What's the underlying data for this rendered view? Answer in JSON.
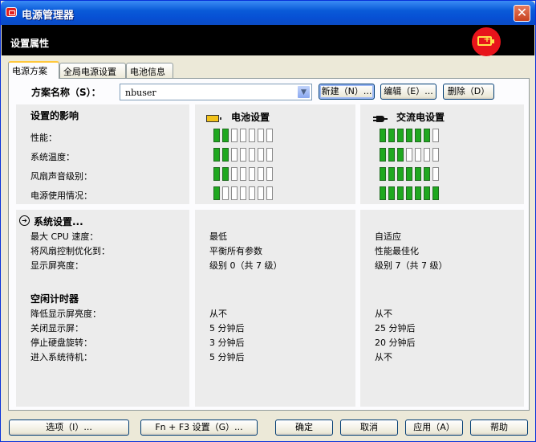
{
  "window": {
    "title": "电源管理器",
    "close_glyph": "✕"
  },
  "header": {
    "title": "设置属性",
    "logo_icon": "battery-charge-logo-icon",
    "logo_plus": "+"
  },
  "tabs": [
    {
      "label": "电源方案",
      "active": true
    },
    {
      "label": "全局电源设置",
      "active": false
    },
    {
      "label": "电池信息",
      "active": false
    }
  ],
  "scheme": {
    "label": "方案名称（S）：",
    "value": "nbuser",
    "buttons": {
      "new": "新建（N）...",
      "edit": "编辑（E）...",
      "delete": "删除（D）"
    }
  },
  "impact": {
    "title": "设置的影响",
    "battery_title": "电池设置",
    "ac_title": "交流电设置",
    "rows": [
      {
        "label": "性能：",
        "battery_level": 2,
        "ac_level": 6
      },
      {
        "label": "系统温度：",
        "battery_level": 2,
        "ac_level": 3
      },
      {
        "label": "风扇声音级别：",
        "battery_level": 2,
        "ac_level": 6
      },
      {
        "label": "电源使用情况：",
        "battery_level": 1,
        "ac_level": 7
      }
    ],
    "segments_total": 7
  },
  "system": {
    "title": "系统设置...",
    "rows": [
      {
        "label": "最大 CPU 速度：",
        "battery": "最低",
        "ac": "自适应"
      },
      {
        "label": "将风扇控制优化到：",
        "battery": "平衡所有参数",
        "ac": "性能最佳化"
      },
      {
        "label": "显示屏亮度：",
        "battery": "级别 0（共 7 级）",
        "ac": "级别 7（共 7 级）"
      }
    ]
  },
  "idle": {
    "title": "空闲计时器",
    "rows": [
      {
        "label": "降低显示屏亮度：",
        "battery": "从不",
        "ac": "从不"
      },
      {
        "label": "关闭显示屏：",
        "battery": "5 分钟后",
        "ac": "25 分钟后"
      },
      {
        "label": "停止硬盘旋转：",
        "battery": "3 分钟后",
        "ac": "20 分钟后"
      },
      {
        "label": "进入系统待机：",
        "battery": "5 分钟后",
        "ac": "从不"
      }
    ]
  },
  "footer": {
    "options": "选项（I）...",
    "fn_f3": "Fn + F3 设置（G）...",
    "ok": "确定",
    "cancel": "取消",
    "apply": "应用（A）",
    "help": "帮助"
  }
}
